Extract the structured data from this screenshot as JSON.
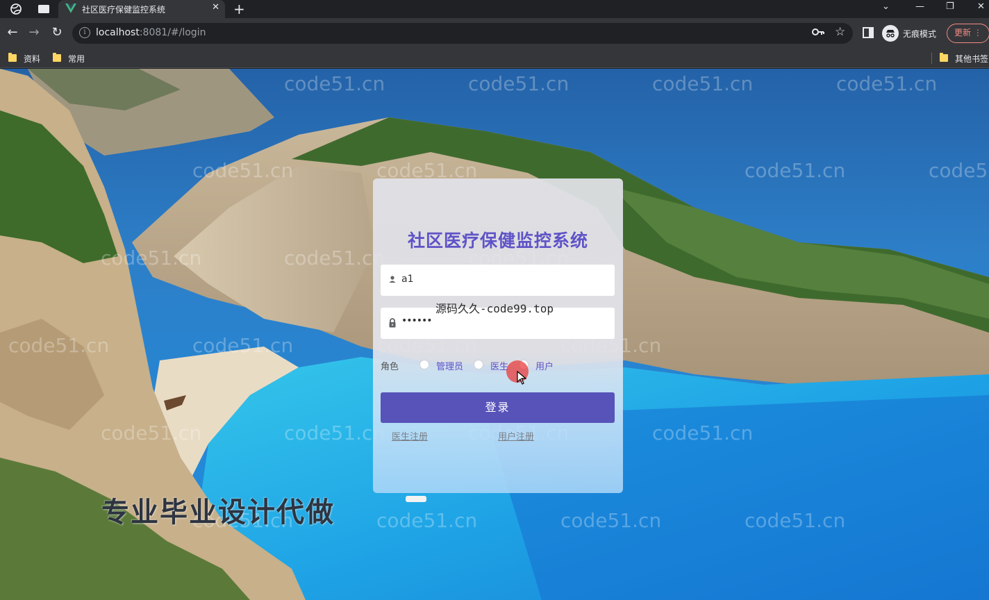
{
  "browser": {
    "tab_title": "社区医疗保健监控系统",
    "url_host": "localhost",
    "url_rest": ":8081/#/login",
    "profile_label": "无痕模式",
    "update_label": "更新",
    "bookmarks": [
      "资料",
      "常用"
    ],
    "other_bookmarks": "其他书签"
  },
  "watermark_text": "code51.cn",
  "overlay_text": "源码久久-code99.top",
  "promo_text": "专业毕业设计代做",
  "login": {
    "title": "社区医疗保健监控系统",
    "username_value": "a1",
    "password_value": "••••••",
    "role_label": "角色",
    "roles": [
      "管理员",
      "医生",
      "用户"
    ],
    "submit_label": "登录",
    "doctor_register": "医生注册",
    "user_register": "用户注册"
  },
  "colors": {
    "accent": "#5f53c7",
    "button": "#5853b8",
    "chrome_dark": "#202124",
    "chrome_mid": "#35363a"
  }
}
